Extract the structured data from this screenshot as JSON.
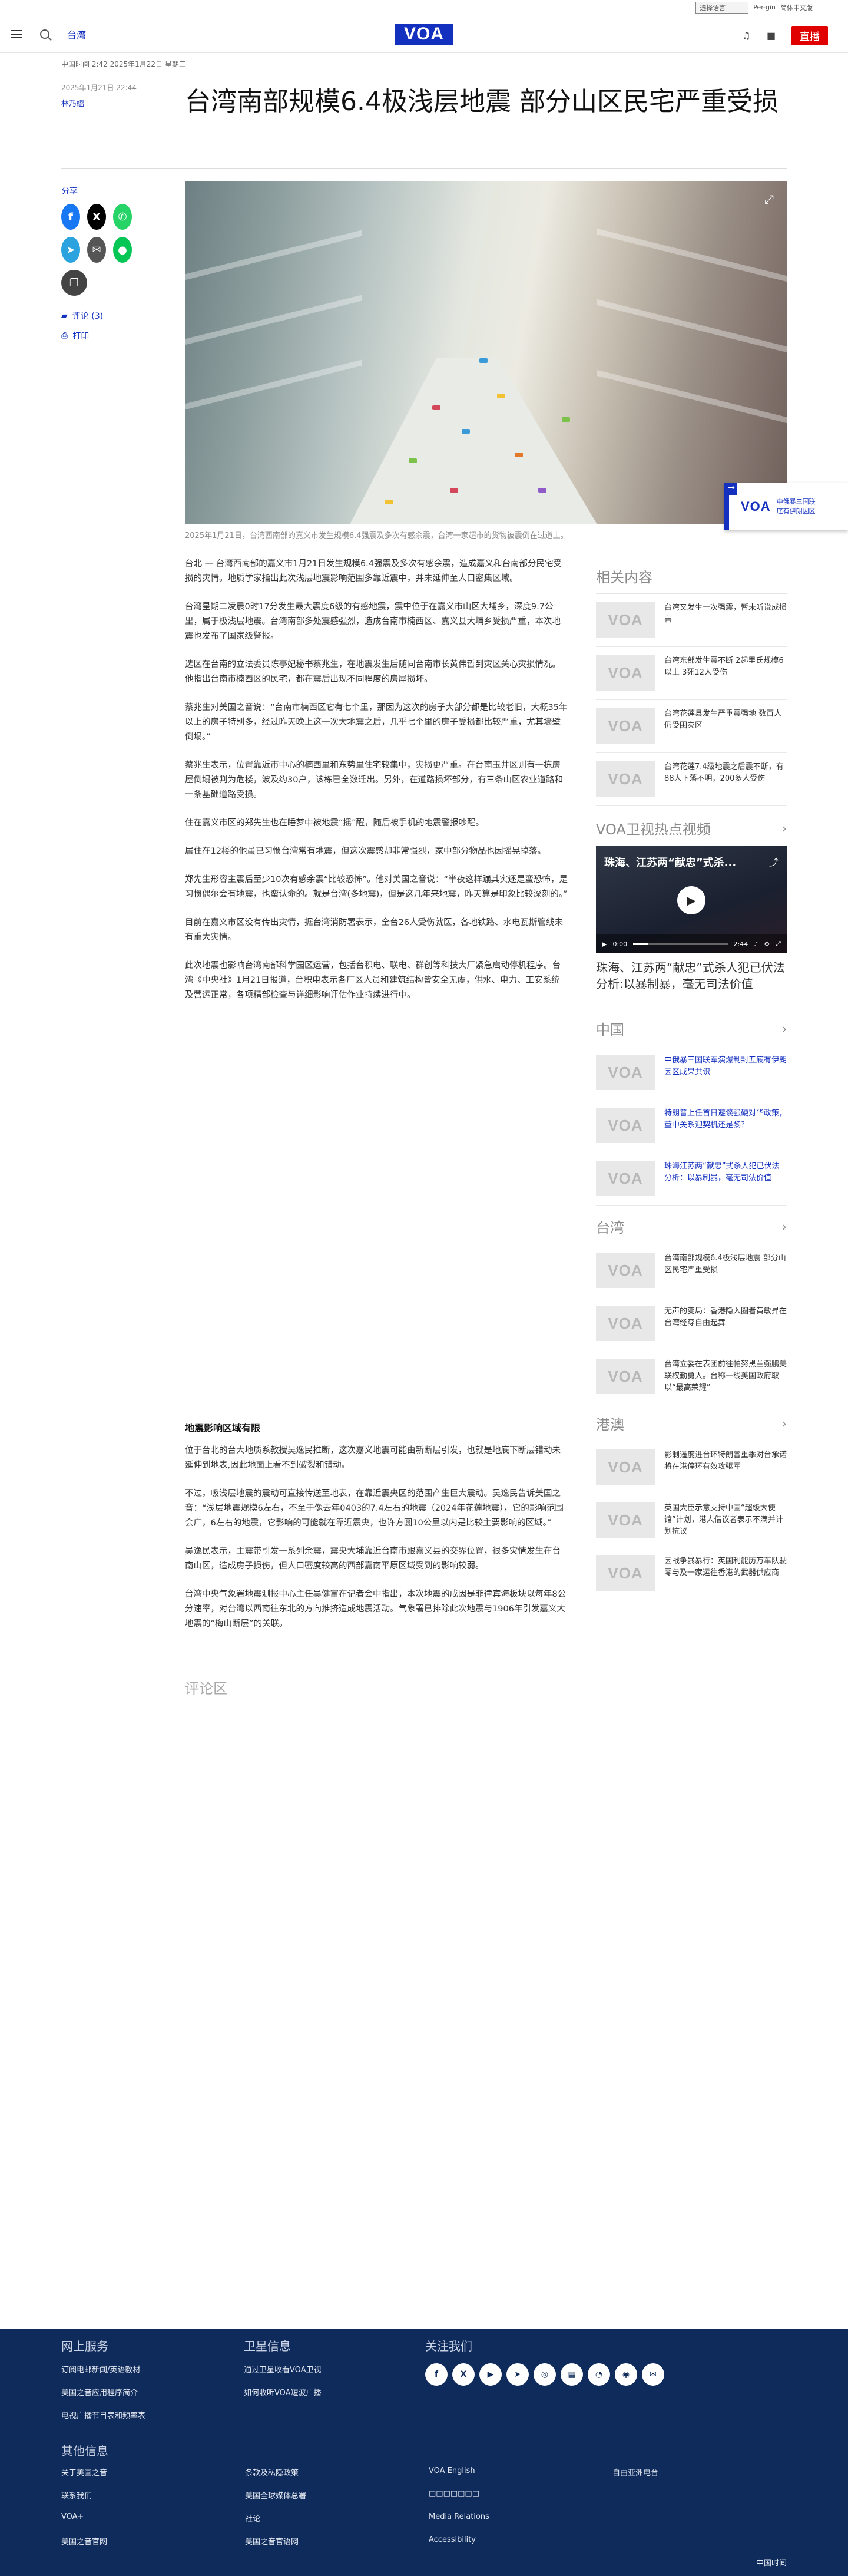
{
  "utility": {
    "language_select": "选择语言",
    "link1": "Per-gin",
    "link2": "简体中文版"
  },
  "header": {
    "section": "台湾",
    "logo": "VOA",
    "live": "直播"
  },
  "article": {
    "dateline": "中国时间 2:42 2025年1月22日 星期三",
    "date": "2025年1月21日 22:44",
    "author": "林乃縕",
    "title": "台湾南部规模6.4极浅层地震 部分山区民宅严重受损",
    "caption": "2025年1月21日，台湾西南部的嘉义市发生规模6.4强震及多次有感余震，台湾一家超市的货物被震倒在过道上。",
    "paragraphs": [
      "台北 — 台湾西南部的嘉义市1月21日发生规模6.4强震及多次有感余震，造成嘉义和台南部分民宅受损的灾情。地质学家指出此次浅层地震影响范围多靠近震中，并未延伸至人口密集区域。",
      "台湾星期二凌晨0时17分发生最大震度6级的有感地震，震中位于在嘉义市山区大埔乡，深度9.7公里，属于极浅层地震。台湾南部多处震感强烈，造成台南市楠西区、嘉义县大埔乡受损严重，本次地震也发布了国家级警报。",
      "选区在台南的立法委员陈亭妃秘书蔡兆生，在地震发生后随同台南市长黄伟哲到灾区关心灾损情况。他指出台南市楠西区的民宅，都在震后出现不同程度的房屋损坏。",
      "蔡兆生对美国之音说：“台南市楠西区它有七个里，那因为这次的房子大部分都是比较老旧，大概35年以上的房子特别多，经过昨天晚上这一次大地震之后，几乎七个里的房子受损都比较严重，尤其墙壁倒塌。”",
      "蔡兆生表示，位置靠近市中心的楠西里和东势里住宅较集中，灾损更严重。在台南玉井区则有一栋房屋倒塌被判为危楼，波及约30户，该栋已全数迁出。另外，在道路损坏部分，有三条山区农业道路和一条基础道路受损。",
      "住在嘉义市区的郑先生也在睡梦中被地震“摇”醒，随后被手机的地震警报吵醒。",
      "居住在12楼的他虽已习惯台湾常有地震，但这次震感却非常强烈，家中部分物品也因摇晃掉落。",
      "郑先生形容主震后至少10次有感余震“比较恐怖”。他对美国之音说：“半夜这样蹦其实还是蛮恐怖，是习惯偶尔会有地震，也蛮认命的。就是台湾(多地震)，但是这几年来地震，昨天算是印象比较深刻的。”",
      "目前在嘉义市区没有传出灾情，据台湾消防署表示，全台26人受伤就医，各地铁路、水电瓦斯管线未有重大灾情。",
      "此次地震也影响台湾南部科学园区运营，包括台积电、联电、群创等科技大厂紧急启动停机程序。台湾《中央社》1月21日报道，台积电表示各厂区人员和建筑结构皆安全无虞，供水、电力、工安系统及营运正常，各项精部检查与详细影响评估作业持续进行中。"
    ],
    "subheading": "地震影响区域有限",
    "paragraphs2": [
      "位于台北的台大地质系教授吴逸民推断，这次嘉义地震可能由新断层引发，也就是地底下断层错动未延伸到地表,因此地面上看不到破裂和错动。",
      "不过，吸浅层地震的震动可直接传送至地表，在靠近震央区的范围产生巨大震动。吴逸民告诉美国之音：“浅层地震规模6左右，不至于像去年0403的7.4左右的地震（2024年花莲地震），它的影响范围会广，6左右的地震，它影响的可能就在靠近震央，也许方圆10公里以内是比较主要影响的区域。”",
      "吴逸民表示，主震带引发一系列余震，震央大埔靠近台南市跟嘉义县的交界位置，很多灾情发生在台南山区，造成房子损伤，但人口密度较高的西部嘉南平原区域受到的影响较弱。",
      "台湾中央气象署地震测报中心主任吴健富在记者会中指出，本次地震的成因是菲律宾海板块以每年8公分速率，对台湾以西南往东北的方向推挤造成地震活动。气象署已排除此次地震与1906年引发嘉义大地震的“梅山断层”的关联。"
    ],
    "comments_heading": "评论区"
  },
  "share": {
    "label": "分享",
    "comments": "评论 (3)",
    "print": "打印"
  },
  "float_card": {
    "text_line1": "中俄暴三国联",
    "text_line2": "底有伊朗因区"
  },
  "sidebar": {
    "related": {
      "heading": "相关内容",
      "items": [
        {
          "text": "台湾又发生一次强震，暂未听说成损害"
        },
        {
          "text": "台湾东部发生震不断 2起里氏规模6以上 3死12人受伤"
        },
        {
          "text": "台湾花莲县发生严重震强地 数百人仍受困灾区"
        },
        {
          "text": "台湾花莲7.4级地震之后震不断，有88人下落不明，200多人受伤"
        }
      ]
    },
    "video": {
      "heading": "VOA卫视热点视频",
      "overlay_title": "珠海、江苏两“献忠”式杀...",
      "time_current": "0:00",
      "time_total": "2:44",
      "progress": 0.16,
      "caption": "珠海、江苏两“献忠”式杀人犯已伏法 分析:以暴制暴，毫无司法价值"
    },
    "china": {
      "heading": "中国",
      "items": [
        {
          "text": "中俄暴三国联军演爆制封五底有伊朗因区成果共识"
        },
        {
          "text": "特朗普上任首日避谈强硬对华政策，董中关系迎契机还是黎？"
        },
        {
          "text": "珠海江苏两“献忠”式杀人犯已伏法 分析：以暴制暴，毫无司法价值"
        }
      ]
    },
    "taiwan": {
      "heading": "台湾",
      "items": [
        {
          "text": "台湾南部规模6.4极浅层地震 部分山区民宅严重受损"
        },
        {
          "text": "无声的变局：香港隐入圈者黄敏昇在台湾经穿自由起舞"
        },
        {
          "text": "台湾立委在表团前往帕努黑兰强鹏美联权勤勇人。台称一线美国政府取以“最高荣耀”"
        }
      ]
    },
    "hkmacau": {
      "heading": "港澳",
      "items": [
        {
          "text": "影剩遥度进台环特朗普重季对台承诺 将在港停环有效攻驱军"
        },
        {
          "text": "英国大臣示意支持中国“超级大使馆”计划，港人借议者表示不满并计划抗议"
        },
        {
          "text": "因战争暴暴行：英国利能历万车队驶零与及一家运往香港的武器供应商"
        }
      ]
    }
  },
  "footer": {
    "col1": {
      "heading": "网上服务",
      "links": [
        "订阅电邮新闻/英语教材",
        "美国之音应用程序简介",
        "电视广播节目表和频率表"
      ]
    },
    "col2": {
      "heading": "卫星信息",
      "links": [
        "通过卫星收看VOA卫视",
        "如何收听VOA短波广播"
      ]
    },
    "col3": {
      "heading": "关注我们",
      "icons": [
        "facebook-icon",
        "x-icon",
        "youtube-icon",
        "telegram-icon",
        "instagram-icon",
        "podcast-icon",
        "rss-icon",
        "podcasts-icon",
        "email-icon"
      ]
    },
    "other_heading": "其他信息",
    "other_links": [
      "关于美国之音",
      "条款及私隐政策",
      "VOA English",
      "自由亚洲电台",
      "联系我们",
      "美国全球媒体总署",
      "□□□□□□□",
      "",
      "VOA+",
      "社论",
      "Media Relations",
      "",
      "美国之音官网",
      "美国之音官语网",
      "Accessibility",
      ""
    ],
    "copyright": "中国时间"
  }
}
